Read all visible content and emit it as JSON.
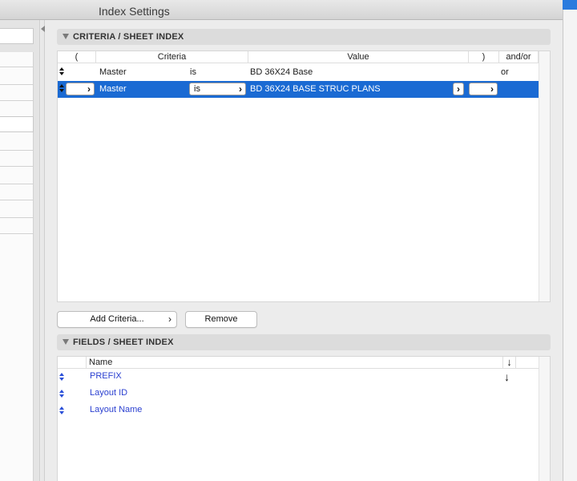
{
  "window": {
    "title": "Index Settings"
  },
  "criteria": {
    "section_title": "CRITERIA /  SHEET INDEX",
    "columns": {
      "open_paren": "(",
      "criteria": "Criteria",
      "value": "Value",
      "close_paren": ")",
      "and_or": "and/or"
    },
    "rows": [
      {
        "criteria": "Master",
        "operator": "is",
        "value": "BD 36X24 Base",
        "and_or": "or"
      },
      {
        "criteria": "Master",
        "operator": "is",
        "value": "BD 36X24 BASE STRUC PLANS",
        "and_or": ""
      }
    ],
    "add_button": "Add Criteria...",
    "remove_button": "Remove"
  },
  "fields": {
    "section_title": "FIELDS /  SHEET INDEX",
    "columns": {
      "name": "Name"
    },
    "items": [
      {
        "name": "PREFIX"
      },
      {
        "name": "Layout ID"
      },
      {
        "name": "Layout Name"
      }
    ]
  },
  "icons": {
    "sort_handle": "up-down-arrows-icon",
    "popup_chevron": "chevron-right-icon",
    "sort_arrow": "down-arrow-icon",
    "disclosure": "disclosure-triangle-icon"
  },
  "colors": {
    "selection": "#1a6ad3",
    "field_link": "#2a3fd0"
  }
}
